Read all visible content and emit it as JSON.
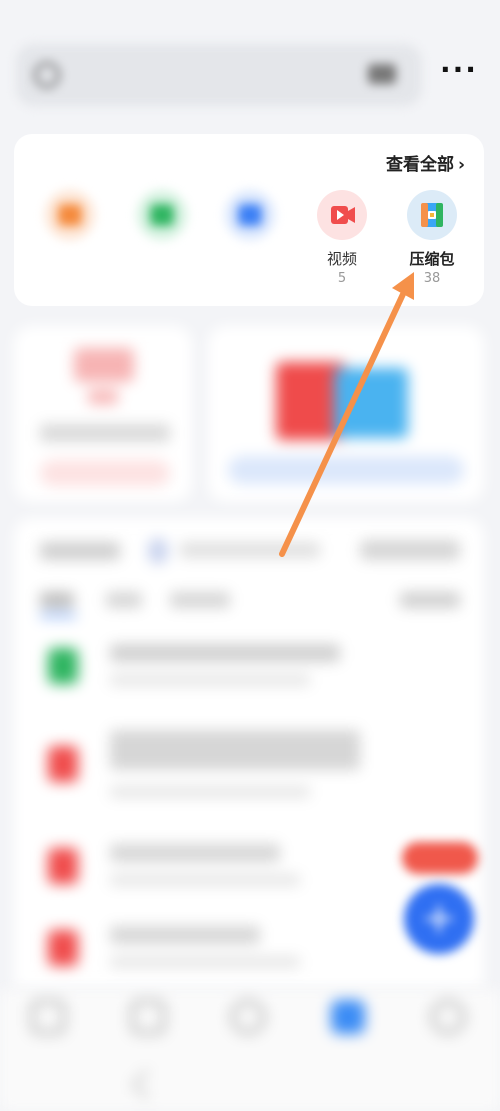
{
  "status_bar": {
    "text": ""
  },
  "search": {
    "placeholder": ""
  },
  "categories": {
    "title": "",
    "view_all": "查看全部",
    "items": [
      {
        "label": "",
        "count": "",
        "color": "#f58a3c",
        "icon": "document-icon"
      },
      {
        "label": "",
        "count": "",
        "color": "#2fb561",
        "icon": "chat-icon"
      },
      {
        "label": "",
        "count": "",
        "color": "#3b7ff5",
        "icon": "image-icon"
      },
      {
        "label": "视频",
        "count": "5",
        "color": "#f04d4d",
        "icon": "video-icon"
      },
      {
        "label": "压缩包",
        "count": "38",
        "color": "#3ba6f5",
        "icon": "archive-icon"
      }
    ]
  },
  "recent_files": [
    {
      "name": "",
      "meta": "",
      "color": "#2fb561"
    },
    {
      "name": "",
      "meta": "",
      "color": "#f04d4d"
    },
    {
      "name": "",
      "meta": "",
      "color": "#f04d4d"
    },
    {
      "name": "",
      "meta": "",
      "color": "#f04d4d"
    }
  ],
  "colors": {
    "accent": "#2f6ff2",
    "annotation_arrow": "#f5914a"
  }
}
